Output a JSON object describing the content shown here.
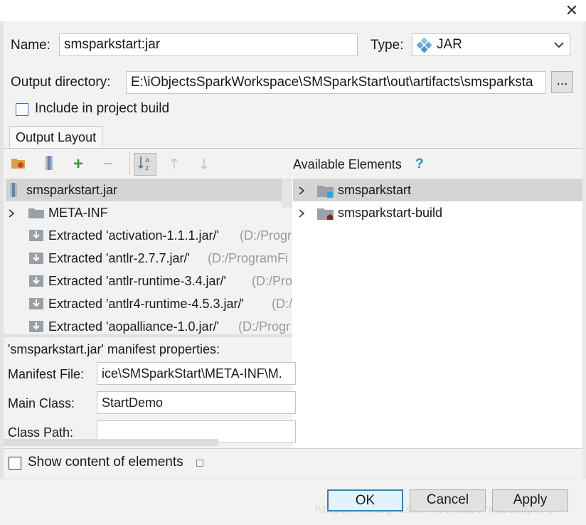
{
  "header": {
    "name_label": "Name:",
    "name_value": "smsparkstart:jar",
    "type_label": "Type:",
    "type_value": "JAR",
    "output_dir_label": "Output directory:",
    "output_dir_value": "E:\\iObjectsSparkWorkspace\\SMSparkStart\\out\\artifacts\\smsparksta",
    "browse_label": "...",
    "include_build_label": "Include in project build"
  },
  "tabs": {
    "output_layout": "Output Layout"
  },
  "left_tree": {
    "root": "smsparkstart.jar",
    "items": [
      {
        "label": "META-INF",
        "path": ""
      },
      {
        "label": "Extracted 'activation-1.1.1.jar/'",
        "path": "(D:/Progr"
      },
      {
        "label": "Extracted 'antlr-2.7.7.jar/'",
        "path": "(D:/ProgramFi"
      },
      {
        "label": "Extracted 'antlr-runtime-3.4.jar/'",
        "path": "(D:/Pro"
      },
      {
        "label": "Extracted 'antlr4-runtime-4.5.3.jar/'",
        "path": "(D:/"
      },
      {
        "label": "Extracted 'aopalliance-1.0.jar/'",
        "path": "(D:/Progr"
      }
    ]
  },
  "right_panel": {
    "title": "Available Elements",
    "help": "?",
    "items": [
      {
        "label": "smsparkstart"
      },
      {
        "label": "smsparkstart-build"
      }
    ]
  },
  "manifest": {
    "title": "'smsparkstart.jar' manifest properties:",
    "manifest_file_label": "Manifest File:",
    "manifest_file_value": "ice\\SMSparkStart\\META-INF\\M.",
    "main_class_label": "Main Class:",
    "main_class_value": "StartDemo",
    "class_path_label": "Class Path:",
    "class_path_value": ""
  },
  "footer": {
    "show_content_label": "Show content of elements",
    "ok": "OK",
    "cancel": "Cancel",
    "apply": "Apply",
    "watermark": "https://blog.csdn.net/supermapsupport"
  },
  "colors": {
    "selection": "#d4d4d4",
    "ok_border": "#3c7fb1",
    "add_green": "#3a9d3a",
    "folder_gray": "#9aa0a8",
    "checkbox_blue": "#2a6fc9"
  }
}
